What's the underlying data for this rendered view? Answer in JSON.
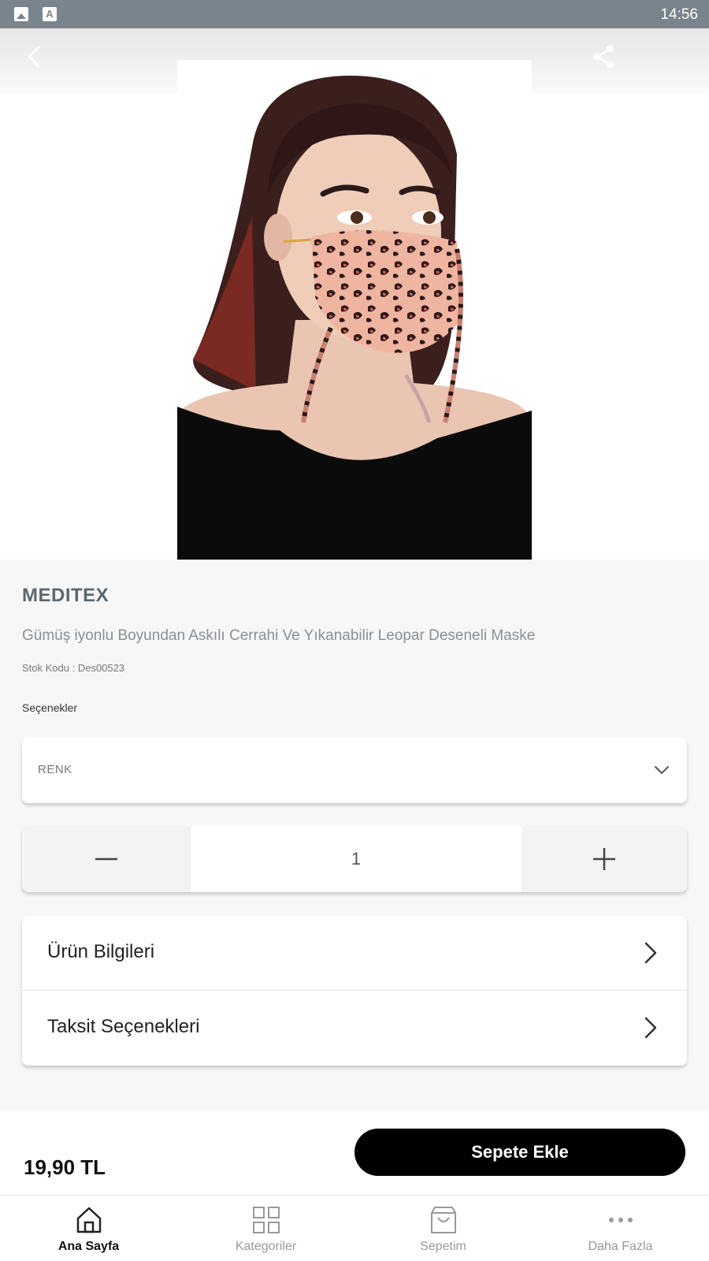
{
  "status_bar": {
    "time": "14:56"
  },
  "hero": {
    "image_alt": "Leopard pattern face mask product photo"
  },
  "product": {
    "brand": "MEDITEX",
    "title": "Gümüş iyonlu Boyundan Askılı Cerrahi Ve Yıkanabilir Leopar Deseneli Maske",
    "sku": "Stok Kodu : Des00523",
    "options_label": "Seçenekler",
    "select_value": "RENK",
    "quantity": "1"
  },
  "info_rows": [
    {
      "label": "Ürün Bilgileri"
    },
    {
      "label": "Taksit Seçenekleri"
    }
  ],
  "price_bar": {
    "price": "19,90 TL",
    "add_to_cart": "Sepete Ekle"
  },
  "bottom_nav": [
    {
      "label": "Ana Sayfa",
      "icon": "home-icon",
      "active": true
    },
    {
      "label": "Kategoriler",
      "icon": "grid-icon",
      "active": false
    },
    {
      "label": "Sepetim",
      "icon": "bag-icon",
      "active": false
    },
    {
      "label": "Daha Fazla",
      "icon": "more-icon",
      "active": false
    }
  ],
  "colors": {
    "brand_text": "#5c6770",
    "status_bar": "#79848c",
    "button_bg": "#000000"
  }
}
